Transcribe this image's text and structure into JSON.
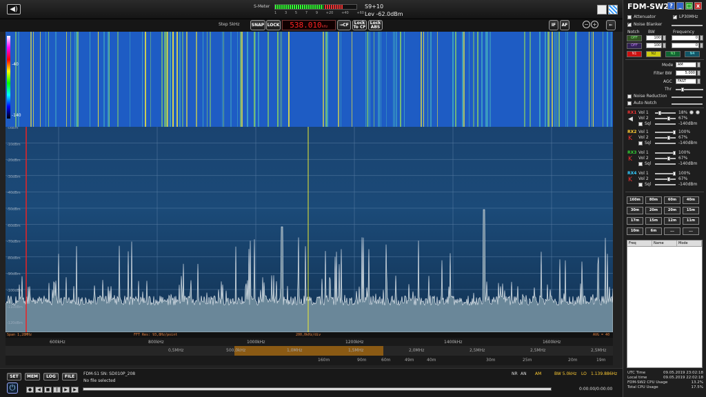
{
  "smeter": {
    "label": "S-Meter",
    "scale": [
      "1",
      "3",
      "5",
      "7",
      "9",
      "+20",
      "+40",
      "+60"
    ],
    "s_reading": "S9+10",
    "level": "Lev -62.0dBm",
    "level_fraction": 0.82
  },
  "controls": {
    "step": "Step 5kHz",
    "snap": "SNAP",
    "lock": "LOCK",
    "frequency": "538.010",
    "freq_unit": "kHz",
    "cf": "→CF",
    "lock_to_cf": [
      "Lock",
      "To CF"
    ],
    "lock_abs": [
      "Lock",
      "ABS"
    ],
    "if_btn": "IF",
    "af_btn": "AF",
    "zoom_out": "−",
    "zoom_in": "+",
    "arrow": "←"
  },
  "waterfall": {
    "top_label": "-40",
    "bottom_label": "-140"
  },
  "spectrum": {
    "ylabels": [
      "-0dBm",
      "-10dBm",
      "-20dBm",
      "-30dBm",
      "-40dBm",
      "-50dBm",
      "-60dBm",
      "-70dBm",
      "-80dBm",
      "-90dBm",
      "-100dBm",
      "-110dBm",
      "-120dBm"
    ],
    "info_span": "Span 1,28MHz",
    "info_fft": "FFT Res: 93,8Hz/point",
    "info_div": "200,0kHz/div",
    "info_avg": "AVG = 40",
    "freq_labels": [
      "600kHz",
      "800kHz",
      "1000kHz",
      "1200kHz",
      "1400kHz",
      "1600kHz"
    ],
    "bands": [
      "0,5MHz",
      "500,0kHz",
      "1,0MHz",
      "1,5MHz",
      "2,0MHz",
      "2,5MHz",
      "2,5MHz",
      "2,5MHz"
    ],
    "meters": [
      "160m",
      "90m",
      "60m",
      "49m",
      "40m",
      "30m",
      "25m",
      "20m",
      "19m"
    ]
  },
  "bottom": {
    "buttons": [
      "SET",
      "MEM",
      "LOG",
      "FILE"
    ],
    "device": "FDM-S1 SN: SD010P_208",
    "file": "No file selected",
    "status_nr": "NR",
    "status_an": "AN",
    "status_mode": "AM",
    "status_bw": "BW 5.0kHz",
    "status_lo": "LO",
    "status_lo_val": "1.139.886Hz",
    "time": "0:00:00/0:00:00"
  },
  "panel": {
    "title": "FDM-SW2",
    "attenuator": "Attenuator",
    "lp30": "LP30MHz",
    "noise_blanker": "Noise Blanker",
    "notch": "Notch",
    "bw": "BW",
    "frequency": "Frequency",
    "notch_bw": [
      "100",
      "100"
    ],
    "notch_freq": [
      "0",
      "0"
    ],
    "notch_btns": [
      "OFF",
      "OFF",
      "N1",
      "N2",
      "N3",
      "N4"
    ],
    "mode_label": "Mode",
    "mode_value": "AM",
    "filter_label": "Filter BW",
    "filter_value": "5.000",
    "agc_label": "AGC",
    "agc_value": "FAST",
    "thr_label": "Thr",
    "noise_reduction": "Noise Reduction",
    "auto_notch": "Auto Notch",
    "rx": [
      {
        "name": "RX1",
        "vol1": "Vol 1",
        "vol1v": "18%",
        "vol2": "Vol 2",
        "vol2v": "67%",
        "sql": "Sql",
        "sqlv": "-140dBm"
      },
      {
        "name": "RX2",
        "vol1": "Vol 1",
        "vol1v": "100%",
        "vol2": "Vol 2",
        "vol2v": "67%",
        "sql": "Sql",
        "sqlv": "-140dBm"
      },
      {
        "name": "RX3",
        "vol1": "Vol 1",
        "vol1v": "100%",
        "vol2": "Vol 2",
        "vol2v": "67%",
        "sql": "Sql",
        "sqlv": "-140dBm"
      },
      {
        "name": "RX4",
        "vol1": "Vol 1",
        "vol1v": "100%",
        "vol2": "Vol 2",
        "vol2v": "67%",
        "sql": "Sql",
        "sqlv": "-140dBm"
      }
    ],
    "lr": [
      "L",
      "R"
    ],
    "bands": [
      "160m",
      "80m",
      "60m",
      "40m",
      "30m",
      "20m",
      "20m",
      "15m",
      "17m",
      "15m",
      "12m",
      "11m",
      "10m",
      "6m",
      "...",
      "..."
    ],
    "mem_headers": [
      "Freq",
      "Name",
      "Mode"
    ],
    "stats": [
      {
        "label": "UTC Time",
        "value": "09.05.2019 23:02:18"
      },
      {
        "label": "Local time",
        "value": "09.05.2019 22:02:18"
      },
      {
        "label": "FDM-SW2 CPU Usage",
        "value": "13.2%"
      },
      {
        "label": "Total CPU Usage",
        "value": "17.5%"
      }
    ]
  }
}
